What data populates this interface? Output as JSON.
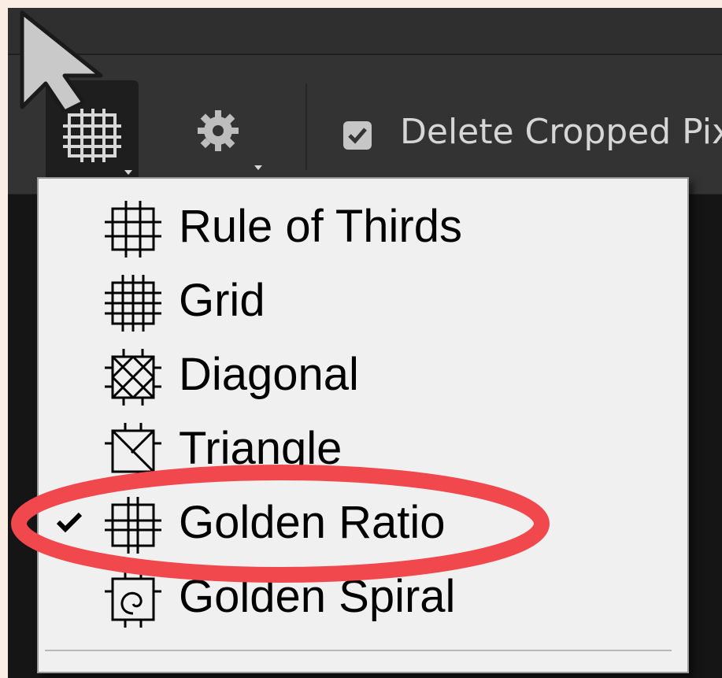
{
  "toolbar": {
    "overlay_button_icon": "grid-overlay-icon",
    "settings_icon": "gear-icon",
    "delete_cropped_checked": true,
    "delete_cropped_label": "Delete Cropped Pix"
  },
  "overlay_menu": {
    "items": [
      {
        "label": "Rule of Thirds",
        "icon": "rule-of-thirds-icon",
        "checked": false
      },
      {
        "label": "Grid",
        "icon": "grid-icon",
        "checked": false
      },
      {
        "label": "Diagonal",
        "icon": "diagonal-icon",
        "checked": false
      },
      {
        "label": "Triangle",
        "icon": "triangle-icon",
        "checked": false
      },
      {
        "label": "Golden Ratio",
        "icon": "golden-ratio-icon",
        "checked": true
      },
      {
        "label": "Golden Spiral",
        "icon": "golden-spiral-icon",
        "checked": false
      }
    ]
  },
  "annotation": {
    "shape": "ellipse",
    "color": "#f0484c",
    "highlights": "Golden Ratio"
  },
  "colors": {
    "title_bar": "#2f2f2f",
    "options_bar": "#333333",
    "menu_background": "#f0f0f0",
    "highlight_ring": "#f0484c"
  }
}
